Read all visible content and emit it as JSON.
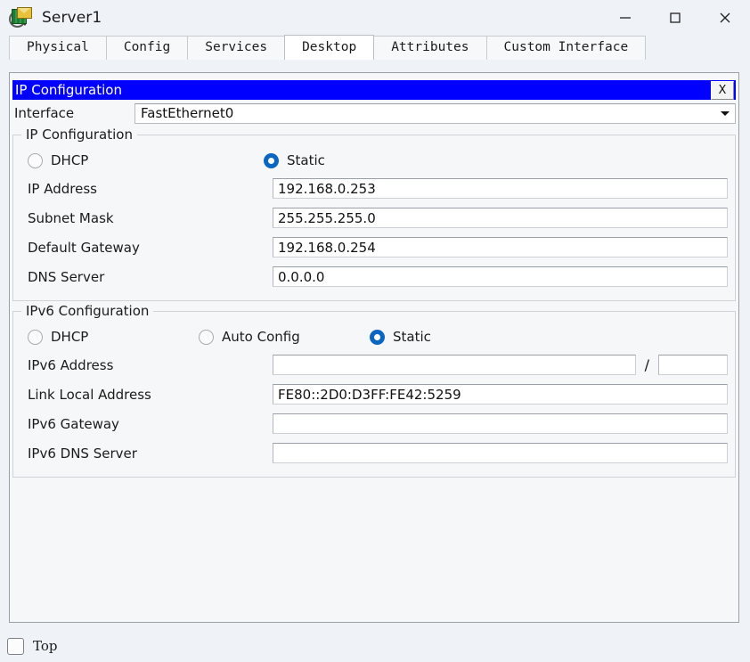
{
  "window": {
    "title": "Server1",
    "icon": "server-magnifier-icon",
    "controls": {
      "minimize": "minimize-icon",
      "maximize": "maximize-icon",
      "close": "close-icon"
    }
  },
  "tabs": [
    {
      "label": "Physical",
      "active": false
    },
    {
      "label": "Config",
      "active": false
    },
    {
      "label": "Services",
      "active": false
    },
    {
      "label": "Desktop",
      "active": true
    },
    {
      "label": "Attributes",
      "active": false
    },
    {
      "label": "Custom Interface",
      "active": false
    }
  ],
  "ip_window": {
    "title": "IP Configuration",
    "close_label": "X",
    "title_bg": "#0000ff",
    "title_fg": "#ffffff"
  },
  "interface": {
    "label": "Interface",
    "value": "FastEthernet0",
    "caret": "chevron-down-icon"
  },
  "ipv4": {
    "legend": "IP Configuration",
    "modes": [
      {
        "label": "DHCP",
        "selected": false
      },
      {
        "label": "Static",
        "selected": true
      }
    ],
    "fields": [
      {
        "label": "IP Address",
        "value": "192.168.0.253"
      },
      {
        "label": "Subnet Mask",
        "value": "255.255.255.0"
      },
      {
        "label": "Default Gateway",
        "value": "192.168.0.254"
      },
      {
        "label": "DNS Server",
        "value": "0.0.0.0"
      }
    ]
  },
  "ipv6": {
    "legend": "IPv6 Configuration",
    "modes": [
      {
        "label": "DHCP",
        "selected": false
      },
      {
        "label": "Auto Config",
        "selected": false
      },
      {
        "label": "Static",
        "selected": true
      }
    ],
    "address": {
      "label": "IPv6 Address",
      "value": "",
      "separator": "/",
      "prefix_value": ""
    },
    "fields": [
      {
        "label": "Link Local Address",
        "value": "FE80::2D0:D3FF:FE42:5259"
      },
      {
        "label": "IPv6 Gateway",
        "value": ""
      },
      {
        "label": "IPv6 DNS Server",
        "value": ""
      }
    ]
  },
  "footer": {
    "top_checkbox_label": "Top",
    "top_checked": false
  },
  "colors": {
    "accent_radio": "#0a66c2",
    "title_blue": "#0000ff",
    "panel_bg": "#f6f7f8",
    "window_bg": "#eff3f7"
  }
}
